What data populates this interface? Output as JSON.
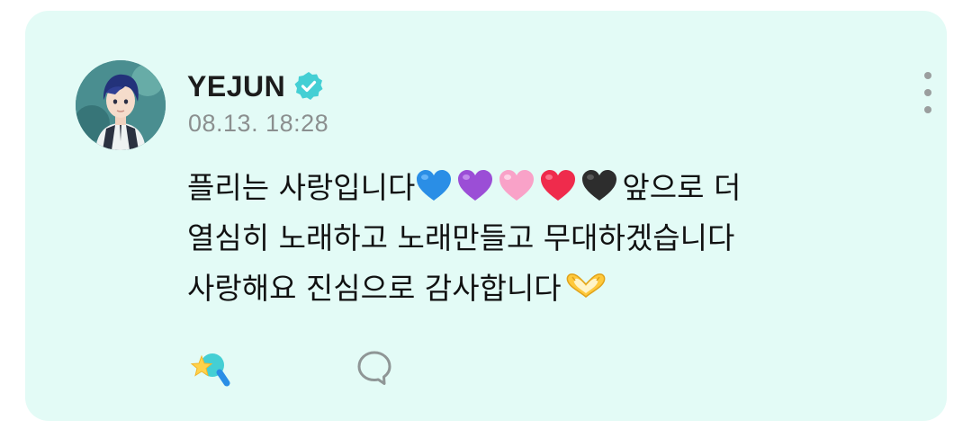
{
  "post": {
    "author": {
      "name": "YEJUN",
      "verified_icon": "verified-badge-icon",
      "avatar": "avatar-image"
    },
    "timestamp": "08.13. 18:28",
    "menu_icon": "more-vertical-icon",
    "body": {
      "line1_text": "플리는 사랑입니다",
      "line1_hearts": [
        "blue-heart-emoji",
        "purple-heart-emoji",
        "pink-heart-emoji",
        "red-heart-emoji",
        "black-heart-emoji"
      ],
      "line1_tail": " 앞으로 더",
      "line2": "열심히 노래하고 노래만들고 무대하겠습니다",
      "line3_text": "사랑해요 진심으로 감사합니다",
      "line3_emoji": "heart-hands-emoji"
    },
    "footer": {
      "like_icon": "star-wand-icon",
      "like_count": "",
      "comment_icon": "comment-bubble-icon",
      "comment_count": ""
    },
    "colors": {
      "card_background": "#e3fbf6",
      "verified": "#44cfd4",
      "heart_blue": "#2a8ee6",
      "heart_purple": "#9b4ed6",
      "heart_pink": "#f9a2c8",
      "heart_red": "#ef2b4c",
      "heart_black": "#2d2d2d"
    }
  }
}
